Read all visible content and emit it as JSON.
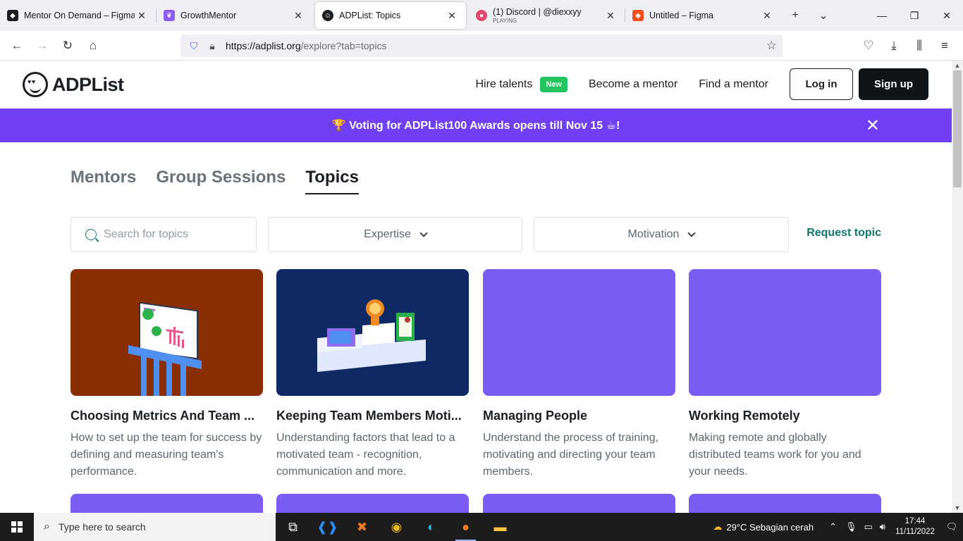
{
  "browser": {
    "tabs": [
      {
        "title": "Mentor On Demand – Figma",
        "favicon_color": "#1e1e1e",
        "sub": ""
      },
      {
        "title": "GrowthMentor",
        "favicon_color": "#8b5cf6",
        "sub": ""
      },
      {
        "title": "ADPList: Topics",
        "favicon_color": "#1b1f23",
        "sub": "",
        "active": true
      },
      {
        "title": "(1) Discord | @diexxyy",
        "favicon_color": "#e04a6a",
        "sub": "PLAYING"
      },
      {
        "title": "Untitled – Figma",
        "favicon_color": "#f24e1e",
        "sub": ""
      }
    ],
    "url_host": "https://adplist.org",
    "url_path": "/explore?tab=topics"
  },
  "site": {
    "logo": "ADPList",
    "nav": {
      "hire": "Hire talents",
      "hire_badge": "New",
      "become": "Become a mentor",
      "find": "Find a mentor",
      "login": "Log in",
      "signup": "Sign up"
    },
    "banner": {
      "text": "🏆 Voting for ADPList100 Awards opens till Nov 15 ☕!",
      "color": "#6f3ef5"
    },
    "tabs": {
      "mentors": "Mentors",
      "groups": "Group Sessions",
      "topics": "Topics"
    },
    "filters": {
      "search_placeholder": "Search for topics",
      "expertise": "Expertise",
      "motivation": "Motivation",
      "request": "Request topic"
    },
    "cards": [
      {
        "title": "Choosing Metrics And Team ...",
        "desc": "How to set up the team for success by defining and measuring team's performance.",
        "bg": "#8a2f04"
      },
      {
        "title": "Keeping Team Members Moti...",
        "desc": "Understanding factors that lead to a motivated team - recognition, communication and more.",
        "bg": "#0f2a63"
      },
      {
        "title": "Managing People",
        "desc": "Understand the process of training, motivating and directing your team members.",
        "bg": "#7b5cf5"
      },
      {
        "title": "Working Remotely",
        "desc": "Making remote and globally distributed teams work for you and your needs.",
        "bg": "#7b5cf5"
      }
    ]
  },
  "taskbar": {
    "search": "Type here to search",
    "weather": "29°C  Sebagian cerah",
    "time": "17:44",
    "date": "11/11/2022"
  }
}
